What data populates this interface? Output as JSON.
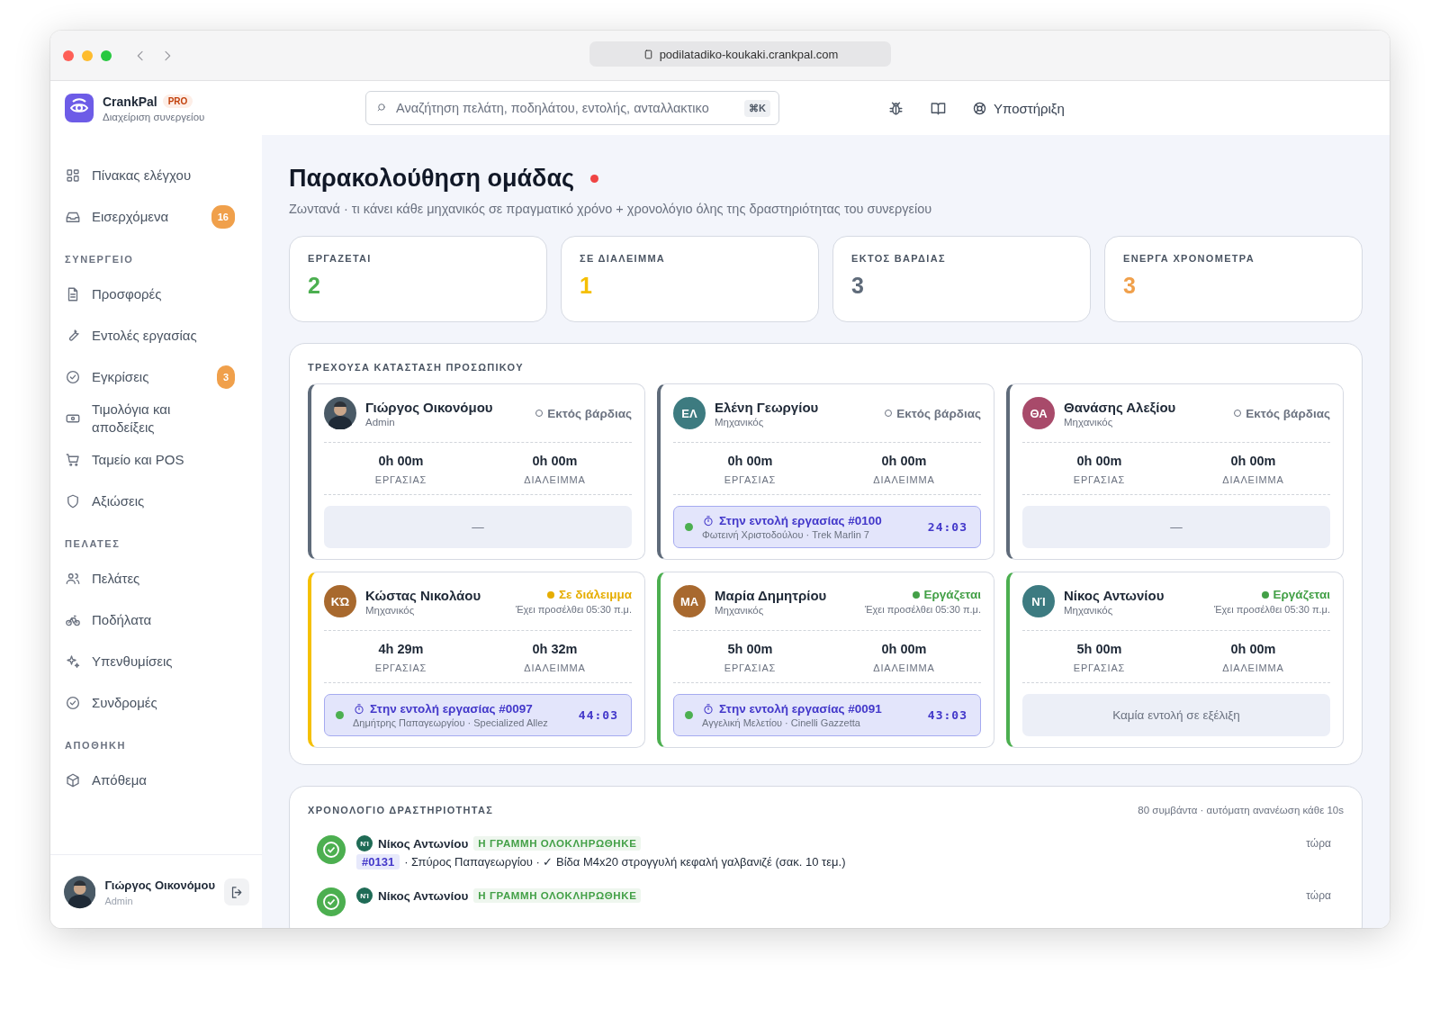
{
  "browser": {
    "url": "podilatadiko-koukaki.crankpal.com"
  },
  "brand": {
    "name": "CrankPal",
    "badge": "PRO",
    "subtitle": "Διαχείριση συνεργείου"
  },
  "search": {
    "placeholder": "Αναζήτηση πελάτη, ποδηλάτου, εντολής, ανταλλακτικο",
    "shortcut": "⌘K"
  },
  "support": {
    "label": "Υποστήριξη"
  },
  "sidebar": {
    "sections": [
      {
        "items": [
          {
            "label": "Πίνακας ελέγχου",
            "selected": false
          },
          {
            "label": "Εισερχόμενα",
            "badge": "16",
            "selected": false
          }
        ]
      },
      {
        "heading": "ΣΥΝΕΡΓΕΙΟ",
        "items": [
          {
            "label": "Προσφορές",
            "selected": false
          },
          {
            "label": "Εντολές εργασίας",
            "selected": false
          },
          {
            "label": "Εγκρίσεις",
            "badge": "3",
            "selected": false
          },
          {
            "label": "Τιμολόγια και αποδείξεις",
            "selected": false
          },
          {
            "label": "Ταμείο και POS",
            "selected": false
          },
          {
            "label": "Αξιώσεις",
            "selected": false
          }
        ]
      },
      {
        "heading": "ΠΕΛΑΤΕΣ",
        "items": [
          {
            "label": "Πελάτες",
            "selected": false
          },
          {
            "label": "Ποδήλατα",
            "selected": false
          },
          {
            "label": "Υπενθυμίσεις",
            "selected": false
          },
          {
            "label": "Συνδρομές",
            "selected": false
          }
        ]
      },
      {
        "heading": "ΑΠΟΘΗΚΗ",
        "items": [
          {
            "label": "Απόθεμα",
            "selected": false
          }
        ]
      }
    ]
  },
  "user": {
    "name": "Γιώργος Οικονόμου",
    "role": "Admin"
  },
  "page": {
    "title": "Παρακολούθηση ομάδας",
    "live": true,
    "subtitle": "Ζωντανά · τι κάνει κάθε μηχανικός σε πραγματικό χρόνο + χρονολόγιο όλης της δραστηριότητας του συνεργείου"
  },
  "stats": [
    {
      "label": "ΕΡΓΑΖΕΤΑΙ",
      "value": "2",
      "color": "#4caf50"
    },
    {
      "label": "ΣΕ ΔΙΑΛΕΙΜΜΑ",
      "value": "1",
      "color": "#f5bf00"
    },
    {
      "label": "ΕΚΤΟΣ ΒΑΡΔΙΑΣ",
      "value": "3",
      "color": "#5f6b7a"
    },
    {
      "label": "ΕΝΕΡΓΑ ΧΡΟΝΟΜΕΤΡΑ",
      "value": "3",
      "color": "#f0a04b"
    }
  ],
  "staff": {
    "heading": "ΤΡΕΧΟΥΣΑ ΚΑΤΑΣΤΑΣΗ ΠΡΟΣΩΠΙΚΟΥ",
    "members": [
      {
        "name": "Γιώργος Οικονόμου",
        "role": "Admin",
        "avatar": {
          "kind": "photo"
        },
        "kind": "off",
        "status_label": "Εκτός βάρδιας",
        "work": "0h 00m",
        "work_label": "ΕΡΓΑΣΙΑΣ",
        "break": "0h 00m",
        "break_label": "ΔΙΑΛΕΙΜΜΑ",
        "task": {
          "kind": "empty",
          "text": "—"
        }
      },
      {
        "name": "Ελένη Γεωργίου",
        "role": "Μηχανικός",
        "avatar": {
          "kind": "initials",
          "initials": "ΕΛ",
          "color": "#3d7b80"
        },
        "kind": "off",
        "status_label": "Εκτός βάρδιας",
        "work": "0h 00m",
        "work_label": "ΕΡΓΑΣΙΑΣ",
        "break": "0h 00m",
        "break_label": "ΔΙΑΛΕΙΜΜΑ",
        "task": {
          "kind": "active",
          "title": "Στην εντολή εργασίας #0100",
          "detail": "Φωτεινή Χριστοδούλου · Trek Marlin 7",
          "timer": "24:03"
        }
      },
      {
        "name": "Θανάσης Αλεξίου",
        "role": "Μηχανικός",
        "avatar": {
          "kind": "initials",
          "initials": "ΘΑ",
          "color": "#a84a6a"
        },
        "kind": "off",
        "status_label": "Εκτός βάρδιας",
        "work": "0h 00m",
        "work_label": "ΕΡΓΑΣΙΑΣ",
        "break": "0h 00m",
        "break_label": "ΔΙΑΛΕΙΜΜΑ",
        "task": {
          "kind": "empty",
          "text": "—"
        }
      },
      {
        "name": "Κώστας Νικολάου",
        "role": "Μηχανικός",
        "avatar": {
          "kind": "initials",
          "initials": "ΚΏ",
          "color": "#a8692e"
        },
        "kind": "break",
        "status_label": "Σε διάλειμμα",
        "clock_in": "Έχει προσέλθει 05:30 π.μ.",
        "work": "4h 29m",
        "work_label": "ΕΡΓΑΣΙΑΣ",
        "break": "0h 32m",
        "break_label": "ΔΙΑΛΕΙΜΜΑ",
        "task": {
          "kind": "active",
          "title": "Στην εντολή εργασίας #0097",
          "detail": "Δημήτρης Παπαγεωργίου · Specialized Allez",
          "timer": "44:03"
        }
      },
      {
        "name": "Μαρία Δημητρίου",
        "role": "Μηχανικός",
        "avatar": {
          "kind": "initials",
          "initials": "ΜΑ",
          "color": "#a8692f"
        },
        "kind": "working",
        "status_label": "Εργάζεται",
        "clock_in": "Έχει προσέλθει 05:30 π.μ.",
        "work": "5h 00m",
        "work_label": "ΕΡΓΑΣΙΑΣ",
        "break": "0h 00m",
        "break_label": "ΔΙΑΛΕΙΜΜΑ",
        "task": {
          "kind": "active",
          "title": "Στην εντολή εργασίας #0091",
          "detail": "Αγγελική Μελετίου · Cinelli Gazzetta",
          "timer": "43:03"
        }
      },
      {
        "name": "Νίκος Αντωνίου",
        "role": "Μηχανικός",
        "avatar": {
          "kind": "initials",
          "initials": "ΝΊ",
          "color": "#3d7b81"
        },
        "kind": "working",
        "status_label": "Εργάζεται",
        "clock_in": "Έχει προσέλθει 05:30 π.μ.",
        "work": "5h 00m",
        "work_label": "ΕΡΓΑΣΙΑΣ",
        "break": "0h 00m",
        "break_label": "ΔΙΑΛΕΙΜΜΑ",
        "task": {
          "kind": "empty",
          "text": "Καμία εντολή σε εξέλιξη"
        }
      }
    ]
  },
  "activity": {
    "heading": "ΧΡΟΝΟΛΟΓΙΟ ΔΡΑΣΤΗΡΙΟΤΗΤΑΣ",
    "meta": "80 συμβάντα · αυτόματη ανανέωση κάθε 10s",
    "events": [
      {
        "initials": "ΝΊ",
        "color": "#1f6b55",
        "user": "Νίκος Αντωνίου",
        "tag": "Η ΓΡΑΜΜΗ ΟΛΟΚΛΗΡΩΘΗΚΕ",
        "order": "#0131",
        "detail": "· Σπύρος Παπαγεωργίου · ✓ Βίδα M4x20 στρογγυλή κεφαλή γαλβανιζέ (σακ. 10 τεμ.)",
        "time": "τώρα"
      },
      {
        "initials": "ΝΊ",
        "color": "#1f6b56",
        "user": "Νίκος Αντωνίου",
        "tag": "Η ΓΡΑΜΜΗ ΟΛΟΚΛΗΡΩΘΗΚΕ",
        "time": "τώρα"
      }
    ]
  }
}
